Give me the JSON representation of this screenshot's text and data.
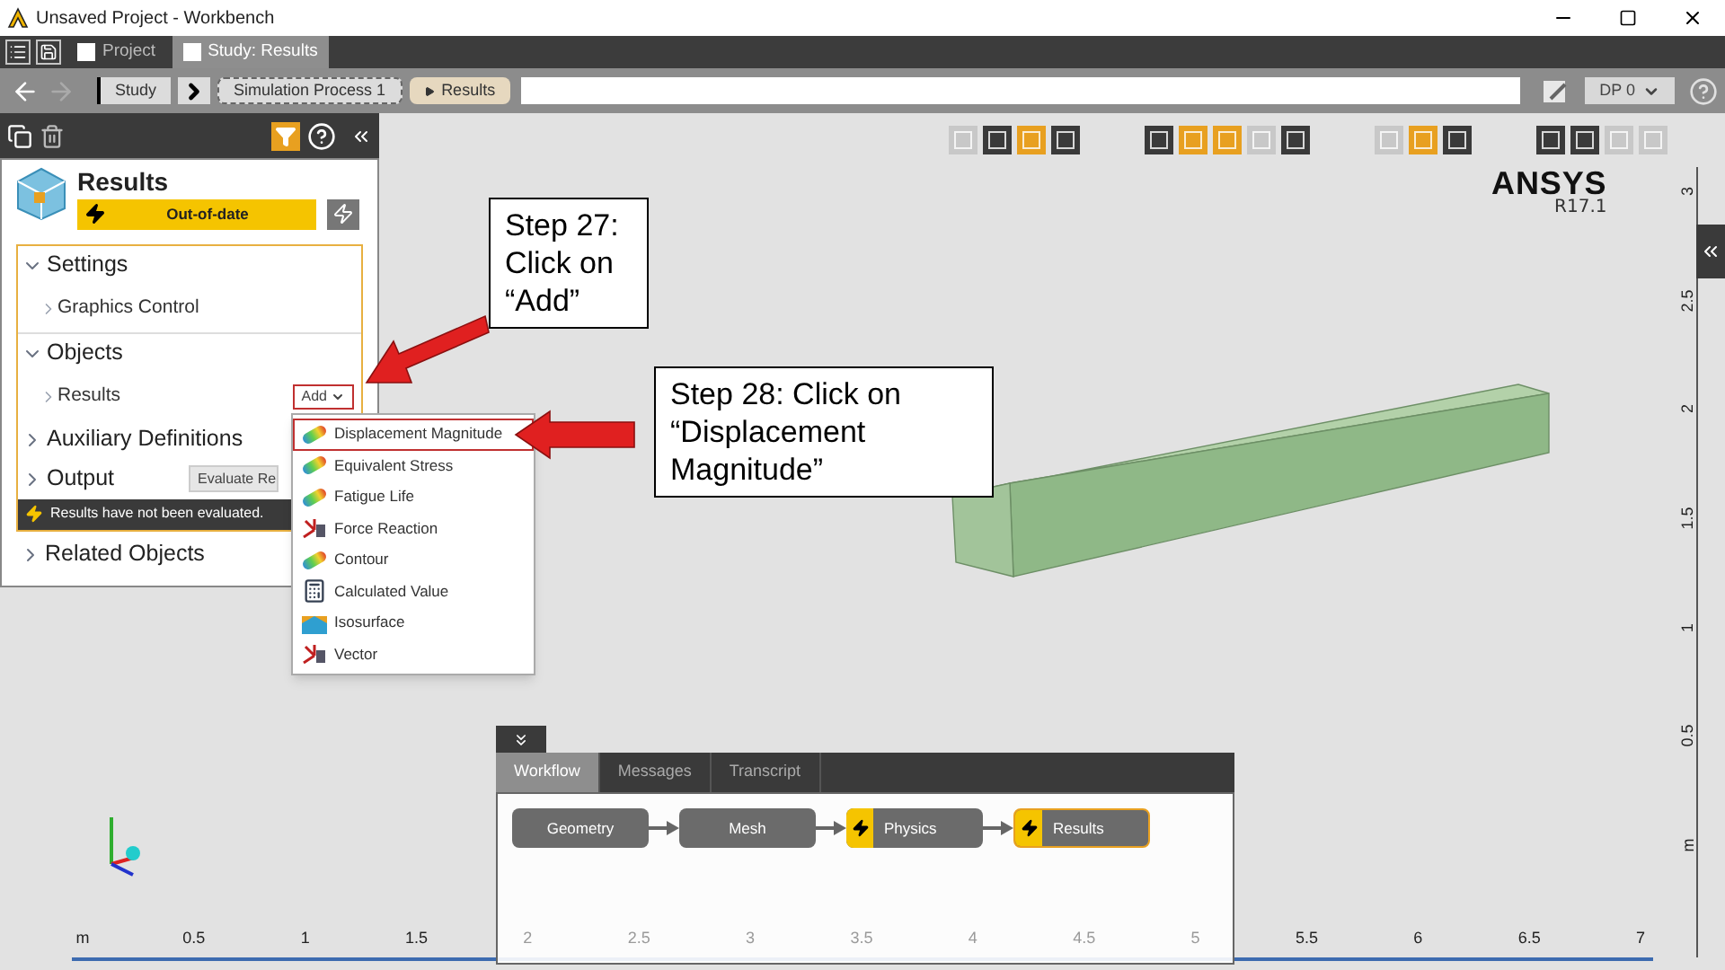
{
  "window": {
    "title": "Unsaved Project - Workbench"
  },
  "tabs": [
    {
      "label": "Project",
      "selected": false
    },
    {
      "label": "Study: Results",
      "selected": true
    }
  ],
  "breadcrumb": [
    {
      "label": "Study",
      "selected": false
    },
    {
      "label": "Simulation Process 1",
      "selected": false
    },
    {
      "label": "Results",
      "selected": true
    }
  ],
  "dp_selector": {
    "value": "DP 0"
  },
  "panel": {
    "title": "Results",
    "status": "Out-of-date",
    "sections": [
      {
        "label": "Settings",
        "expanded": true,
        "children": [
          {
            "label": "Graphics Control"
          }
        ]
      },
      {
        "label": "Objects",
        "expanded": true,
        "children": [
          {
            "label": "Results",
            "action": "Add"
          }
        ]
      },
      {
        "label": "Auxiliary Definitions",
        "expanded": false
      },
      {
        "label": "Output",
        "expanded": false,
        "action": "Evaluate Re"
      }
    ],
    "message": "Results have not been evaluated.",
    "related": {
      "label": "Related Objects",
      "expanded": false
    }
  },
  "add_menu": [
    {
      "label": "Displacement Magnitude",
      "kind": "contour",
      "selected": true
    },
    {
      "label": "Equivalent Stress",
      "kind": "contour",
      "selected": false
    },
    {
      "label": "Fatigue Life",
      "kind": "contour",
      "selected": false
    },
    {
      "label": "Force Reaction",
      "kind": "reaction",
      "selected": false
    },
    {
      "label": "Contour",
      "kind": "contour",
      "selected": false
    },
    {
      "label": "Calculated Value",
      "kind": "calc",
      "selected": false
    },
    {
      "label": "Isosurface",
      "kind": "iso",
      "selected": false
    },
    {
      "label": "Vector",
      "kind": "reaction",
      "selected": false
    }
  ],
  "callouts": [
    {
      "text": "Step 27:\nClick on\n“Add”"
    },
    {
      "text": "Step 28: Click on\n“Displacement\nMagnitude”"
    }
  ],
  "toolbar": [
    [
      {
        "selected": false,
        "disabled": true
      },
      {
        "selected": false,
        "disabled": false
      },
      {
        "selected": true,
        "disabled": false
      },
      {
        "selected": false,
        "disabled": false
      }
    ],
    [
      {
        "selected": false,
        "disabled": false
      },
      {
        "selected": true,
        "disabled": false
      },
      {
        "selected": true,
        "disabled": false
      },
      {
        "selected": false,
        "disabled": true
      },
      {
        "selected": false,
        "disabled": false
      }
    ],
    [
      {
        "selected": false,
        "disabled": true
      },
      {
        "selected": true,
        "disabled": false
      },
      {
        "selected": false,
        "disabled": false
      }
    ],
    [
      {
        "selected": false,
        "disabled": false
      },
      {
        "selected": false,
        "disabled": false
      },
      {
        "selected": false,
        "disabled": true
      },
      {
        "selected": false,
        "disabled": true
      }
    ]
  ],
  "logo": {
    "name": "ANSYS",
    "version": "R17.1"
  },
  "ruler_vertical": [
    "3",
    "2.5",
    "2",
    "1.5",
    "1",
    "0.5",
    "m"
  ],
  "ruler_horizontal": [
    {
      "label": "m",
      "faded": false
    },
    {
      "label": "0.5",
      "faded": false
    },
    {
      "label": "1",
      "faded": false
    },
    {
      "label": "1.5",
      "faded": false
    },
    {
      "label": "2",
      "faded": true
    },
    {
      "label": "2.5",
      "faded": true
    },
    {
      "label": "3",
      "faded": true
    },
    {
      "label": "3.5",
      "faded": true
    },
    {
      "label": "4",
      "faded": true
    },
    {
      "label": "4.5",
      "faded": true
    },
    {
      "label": "5",
      "faded": true
    },
    {
      "label": "5.5",
      "faded": false
    },
    {
      "label": "6",
      "faded": false
    },
    {
      "label": "6.5",
      "faded": false
    },
    {
      "label": "7",
      "faded": false
    }
  ],
  "workflow": {
    "tabs": [
      {
        "label": "Workflow",
        "selected": true
      },
      {
        "label": "Messages",
        "selected": false
      },
      {
        "label": "Transcript",
        "selected": false
      }
    ],
    "nodes": [
      {
        "label": "Geometry",
        "kind": "plain",
        "highlighted": false
      },
      {
        "label": "Mesh",
        "kind": "plain",
        "highlighted": false
      },
      {
        "label": "Physics",
        "kind": "pending",
        "highlighted": false
      },
      {
        "label": "Results",
        "kind": "pending",
        "highlighted": true
      }
    ]
  }
}
